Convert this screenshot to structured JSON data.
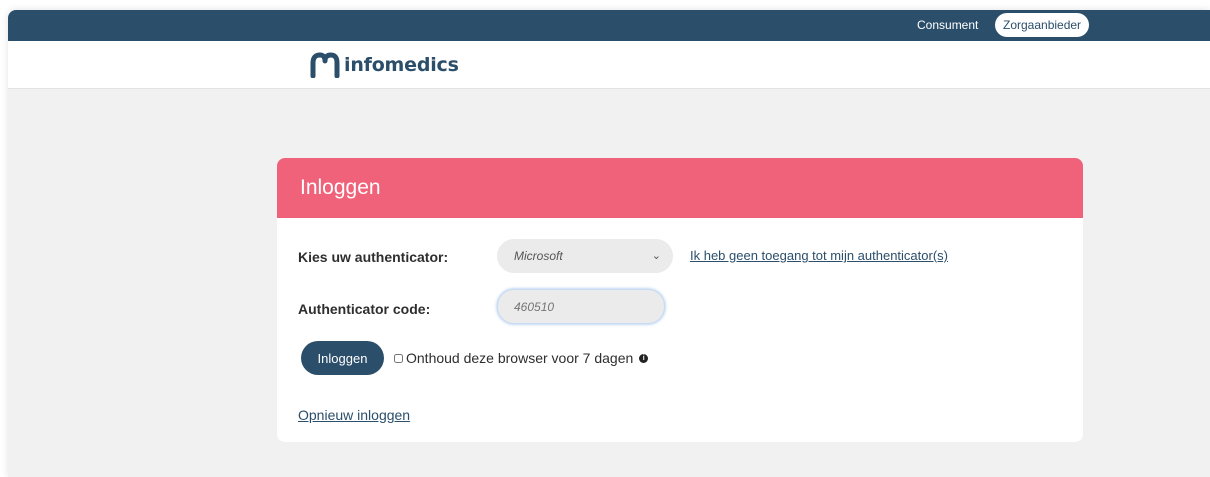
{
  "topbar": {
    "consumer_label": "Consument",
    "provider_label": "Zorgaanbieder"
  },
  "header": {
    "logo_text": "infomedics"
  },
  "login_card": {
    "title": "Inloggen",
    "authenticator_label": "Kies uw authenticator:",
    "authenticator_selected": "Microsoft",
    "no_access_link": "Ik heb geen toegang tot mijn authenticator(s)",
    "code_label": "Authenticator code:",
    "code_placeholder": "460510",
    "login_button": "Inloggen",
    "remember_label": "Onthoud deze browser voor 7 dagen",
    "relogin_link": "Opnieuw inloggen"
  },
  "colors": {
    "navy": "#2b4e6b",
    "card_header": "#ef6279",
    "background": "#f1f1f1"
  }
}
